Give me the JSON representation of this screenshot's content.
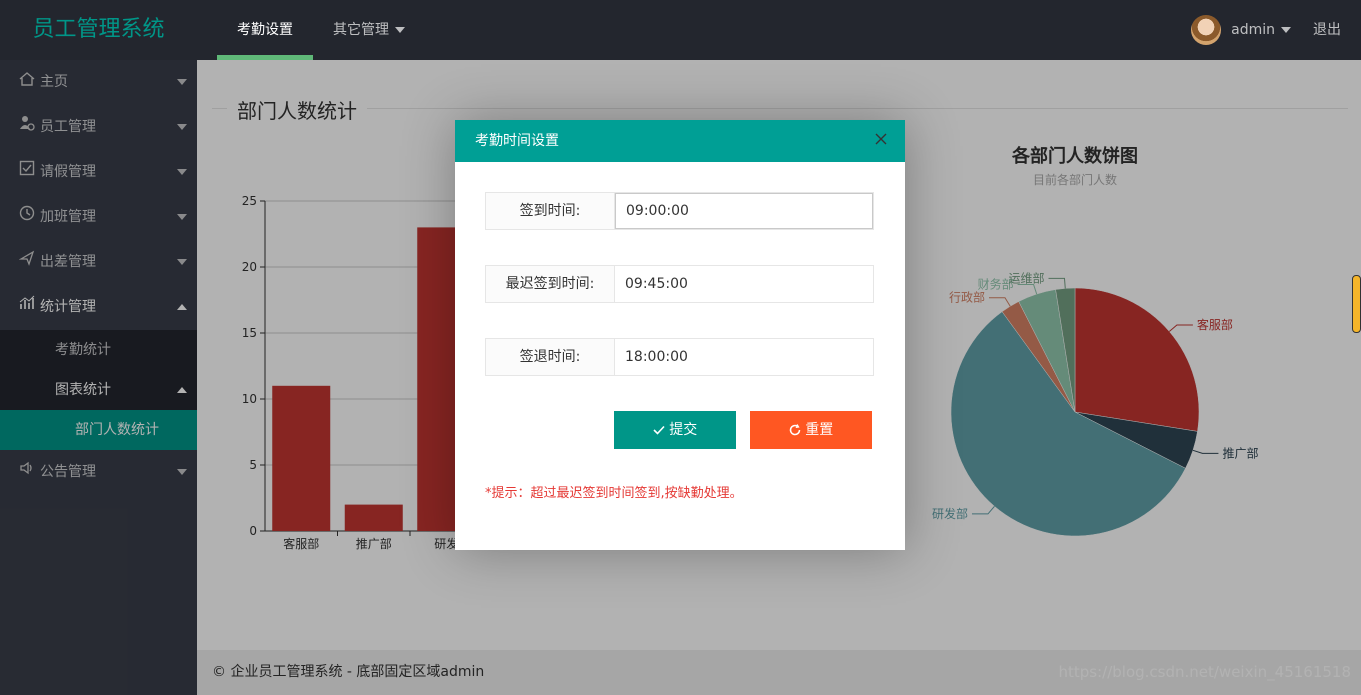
{
  "header": {
    "logo": "员工管理系统",
    "nav": [
      {
        "label": "考勤设置",
        "active": true
      },
      {
        "label": "其它管理",
        "active": false
      }
    ],
    "user_name": "admin",
    "logout": "退出"
  },
  "sidebar": {
    "items": [
      {
        "label": "主页",
        "icon": "home-icon"
      },
      {
        "label": "员工管理",
        "icon": "employee-icon"
      },
      {
        "label": "请假管理",
        "icon": "leave-icon"
      },
      {
        "label": "加班管理",
        "icon": "overtime-icon"
      },
      {
        "label": "出差管理",
        "icon": "plane-icon"
      },
      {
        "label": "统计管理",
        "icon": "chart-icon"
      },
      {
        "label": "公告管理",
        "icon": "speaker-icon"
      }
    ],
    "sub": {
      "attendance": "考勤统计",
      "charts": "图表统计",
      "dept": "部门人数统计"
    }
  },
  "content": {
    "section_title": "部门人数统计"
  },
  "chart_data": [
    {
      "type": "bar",
      "categories": [
        "客服部",
        "推广部",
        "研发"
      ],
      "values": [
        11,
        2,
        23
      ],
      "ylim": [
        0,
        25
      ],
      "yticks": [
        0,
        5,
        10,
        15,
        20,
        25
      ],
      "color": "#c23531"
    },
    {
      "type": "pie",
      "title": "各部门人数饼图",
      "subtitle": "目前各部门人数",
      "slices": [
        {
          "name": "客服部",
          "value": 11,
          "color": "#c23531"
        },
        {
          "name": "推广部",
          "value": 2,
          "color": "#2f4554"
        },
        {
          "name": "研发部",
          "value": 23,
          "color": "#61a0a8"
        },
        {
          "name": "行政部",
          "value": 1,
          "color": "#d48265"
        },
        {
          "name": "财务部",
          "value": 2,
          "color": "#91c7ae"
        },
        {
          "name": "运维部",
          "value": 1,
          "color": "#749f83"
        }
      ]
    }
  ],
  "footer": {
    "text": "© 企业员工管理系统 - 底部固定区域admin",
    "watermark": "https://blog.csdn.net/weixin_45161518"
  },
  "dialog": {
    "title": "考勤时间设置",
    "fields": [
      {
        "label": "签到时间:",
        "value": "09:00:00"
      },
      {
        "label": "最迟签到时间:",
        "value": "09:45:00"
      },
      {
        "label": "签退时间:",
        "value": "18:00:00"
      }
    ],
    "submit": "提交",
    "reset": "重置",
    "tip": "*提示：超过最迟签到时间签到,按缺勤处理。"
  }
}
